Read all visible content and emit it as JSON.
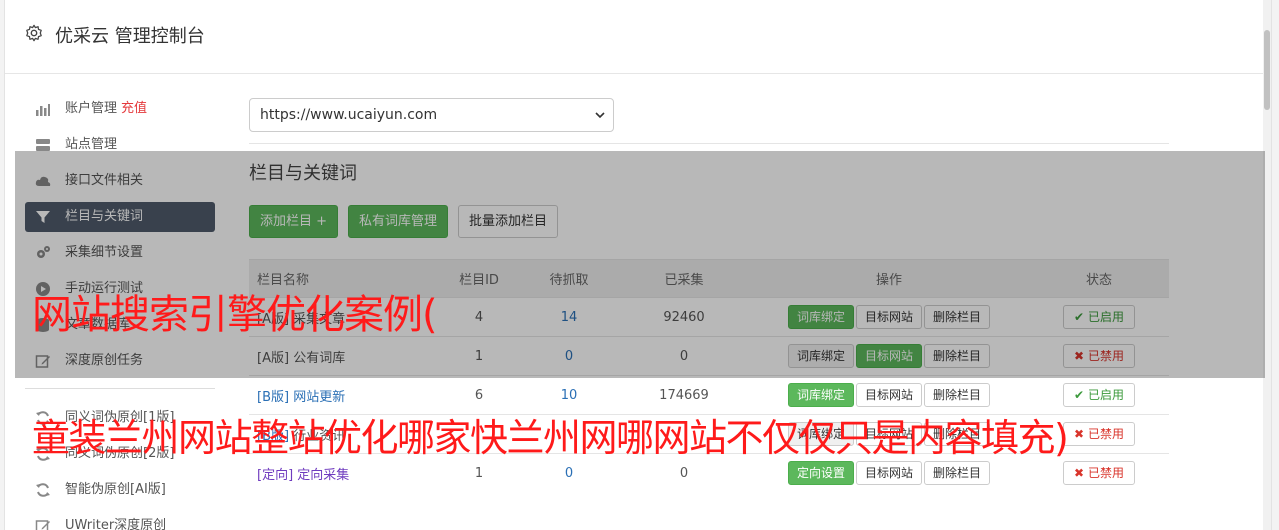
{
  "header": {
    "title": "优采云 管理控制台",
    "icon": "gear-icon"
  },
  "sidebar": {
    "items": [
      {
        "label": "账户管理",
        "extra": "充值",
        "icon": "bar-chart-icon"
      },
      {
        "label": "站点管理",
        "icon": "server-icon"
      },
      {
        "label": "接口文件相关",
        "icon": "cloud-icon"
      },
      {
        "label": "栏目与关键词",
        "icon": "filter-icon",
        "active": true
      },
      {
        "label": "采集细节设置",
        "icon": "cogs-icon"
      },
      {
        "label": "手动运行测试",
        "icon": "play-icon"
      },
      {
        "label": "文章数据库",
        "icon": "database-icon"
      },
      {
        "label": "深度原创任务",
        "icon": "edit-icon"
      }
    ],
    "items2": [
      {
        "label": "同义词伪原创[1版]",
        "icon": "refresh-icon"
      },
      {
        "label": "同义词伪原创[2版]",
        "icon": "refresh-icon"
      },
      {
        "label": "智能伪原创[AI版]",
        "icon": "refresh-icon"
      },
      {
        "label": "UWriter深度原创",
        "icon": "edit-icon"
      }
    ]
  },
  "main": {
    "site_select": "https://www.ucaiyun.com",
    "section_title": "栏目与关键词",
    "buttons": {
      "add": "添加栏目 +",
      "private_lib": "私有词库管理",
      "batch_add": "批量添加栏目"
    },
    "table": {
      "headers": [
        "栏目名称",
        "栏目ID",
        "待抓取",
        "已采集",
        "操作",
        "状态"
      ],
      "rows": [
        {
          "tag": "",
          "name": "[A版] 采集文章",
          "id": "4",
          "pending": "14",
          "collected": "92460",
          "op1": "词库绑定",
          "op2": "目标网站",
          "op3": "删除栏目",
          "status": "已启用",
          "enabled": true
        },
        {
          "tag": "[A版]",
          "name": "公有词库",
          "id": "1",
          "pending": "0",
          "collected": "0",
          "op1": "词库绑定",
          "op2": "目标网站",
          "op3": "删除栏目",
          "status": "已禁用",
          "enabled": false
        },
        {
          "tag": "[B版]",
          "name": "网站更新",
          "id": "6",
          "pending": "10",
          "collected": "174669",
          "op1": "词库绑定",
          "op2": "目标网站",
          "op3": "删除栏目",
          "status": "已启用",
          "enabled": true
        },
        {
          "tag": "[B版]",
          "name": "行业资讯",
          "id": "",
          "pending": "",
          "collected": "",
          "op1": "词库绑定",
          "op2": "目标网站",
          "op3": "删除栏目",
          "status": "已禁用",
          "enabled": false
        },
        {
          "tag": "[定向]",
          "name": "定向采集",
          "id": "1",
          "pending": "0",
          "collected": "0",
          "op1": "定向设置",
          "op2": "目标网站",
          "op3": "删除栏目",
          "status": "已禁用",
          "enabled": false
        }
      ]
    }
  },
  "overlay": {
    "line1": "网站搜索引擎优化案例(",
    "line2": "童装兰州网站整站优化哪家快兰州网哪网站不仅仅只是内容填充)"
  }
}
